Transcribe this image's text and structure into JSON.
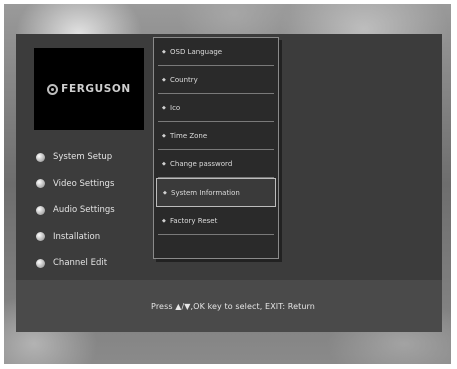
{
  "brand": {
    "logo_text": "FERGUSON"
  },
  "main_menu": {
    "items": [
      {
        "label": "System Setup"
      },
      {
        "label": "Video Settings"
      },
      {
        "label": "Audio Settings"
      },
      {
        "label": "Installation"
      },
      {
        "label": "Channel Edit"
      }
    ]
  },
  "sub_menu": {
    "selected_index": 5,
    "items": [
      {
        "label": "OSD Language"
      },
      {
        "label": "Country"
      },
      {
        "label": "Ico"
      },
      {
        "label": "Time Zone"
      },
      {
        "label": "Change password"
      },
      {
        "label": "System Information"
      },
      {
        "label": "Factory Reset"
      }
    ]
  },
  "help_bar": {
    "text": "Press ▲/▼,OK key to select, EXIT: Return"
  },
  "colors": {
    "panel": "#3c3c3c",
    "help_bar": "#4a4a4a",
    "submenu_bg": "#2a2a2a",
    "text": "#e4e4e4",
    "logo_bg": "#000000"
  }
}
